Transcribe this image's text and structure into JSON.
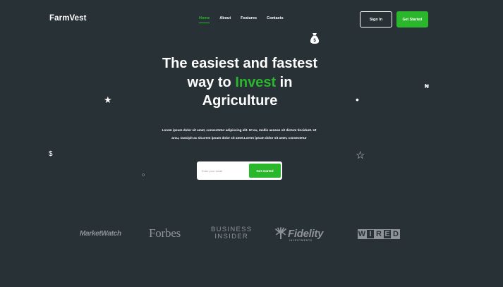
{
  "header": {
    "logo": "FarmVest",
    "nav": [
      {
        "label": "Home",
        "active": true
      },
      {
        "label": "About",
        "active": false
      },
      {
        "label": "Features",
        "active": false
      },
      {
        "label": "Contacts",
        "active": false
      }
    ],
    "sign_in": "Sign In",
    "get_started": "Get Started"
  },
  "hero": {
    "title_line1": "The easiest and fastest",
    "title_line2_pre": "way to ",
    "title_line2_accent": "Invest",
    "title_line2_post": " in",
    "title_line3": "Agriculture",
    "description": "Lorem ipsum dolor sit amet, consectetur adipiscing elit. Ut eu, mollis aenean sit dictum tincidunt. Ut arcu, suscipit ac sit.orem ipsum dolor sit amet.Lorem ipsum dolor sit amet, consectetur",
    "email_placeholder": "Enter your email",
    "subscribe_button": "Get started"
  },
  "decorations": {
    "star_filled": "★",
    "star_outline": "☆",
    "dollar": "$",
    "naira": "₦",
    "dot": "•",
    "ring": "○",
    "money_bag": "money-bag-icon"
  },
  "press": {
    "marketwatch": "MarketWatch",
    "forbes": "Forbes",
    "business_line1": "BUSINESS",
    "business_line2": "INSIDER",
    "fidelity": "Fidelity",
    "fidelity_sub": "INVESTMENTS",
    "wired": [
      "W",
      "I",
      "R",
      "E",
      "D"
    ]
  },
  "colors": {
    "background": "#283136",
    "accent": "#2bb72c",
    "text": "#ffffff",
    "logo_grey": "#8d9396"
  }
}
